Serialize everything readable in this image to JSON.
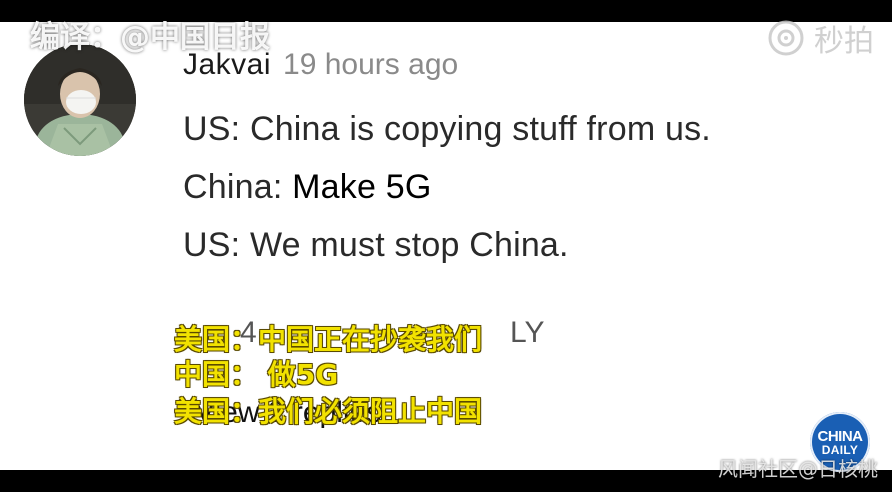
{
  "watermarks": {
    "credit": "编译：@中国日报",
    "platform": "秒拍",
    "community": "风闻社区@日核桃",
    "badge_top": "CHINA",
    "badge_bottom": "DAILY"
  },
  "comment": {
    "username": "Jakvai",
    "timestamp": "19 hours ago",
    "lines": [
      {
        "prefix": "US: ",
        "text": "China is copying stuff from us."
      },
      {
        "prefix": "China: ",
        "text": "Make 5G"
      },
      {
        "prefix": "US: ",
        "text": "We must stop China."
      }
    ],
    "likes": "4",
    "reply_label": "LY",
    "view_replies": "View 2 replies"
  },
  "subtitles": [
    "美国：中国正在抄袭我们",
    "中国：  做5G",
    "美国：我们必须阻止中国"
  ],
  "colors": {
    "subtitle": "#f2e200",
    "badge": "#1a5fb4",
    "panel": "#ffffff"
  }
}
